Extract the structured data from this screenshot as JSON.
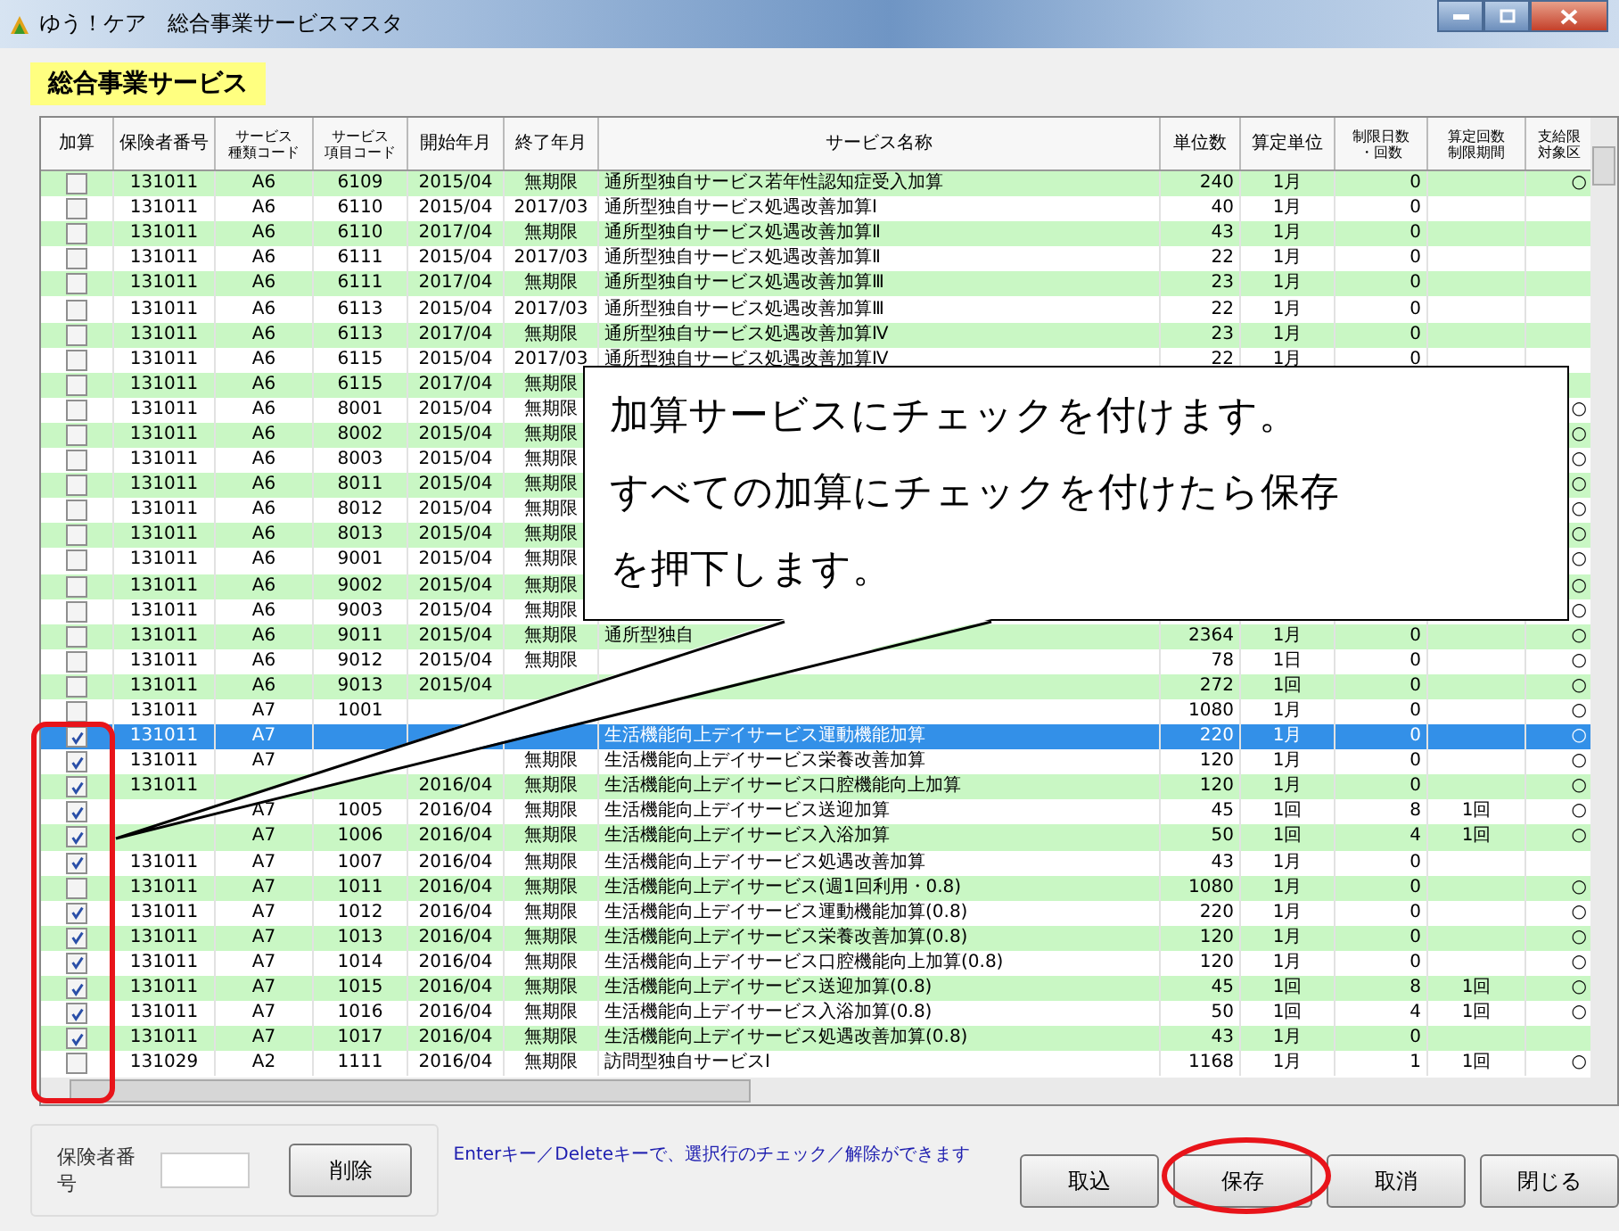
{
  "window": {
    "title": "ゆう！ケア　総合事業サービスマスタ"
  },
  "heading": "総合事業サービス",
  "table": {
    "columns": [
      {
        "lines": [
          "加算"
        ]
      },
      {
        "lines": [
          "保険者番号"
        ]
      },
      {
        "lines": [
          "サービス",
          "種類コード"
        ]
      },
      {
        "lines": [
          "サービス",
          "項目コード"
        ]
      },
      {
        "lines": [
          "開始年月"
        ]
      },
      {
        "lines": [
          "終了年月"
        ]
      },
      {
        "lines": [
          "サービス名称"
        ]
      },
      {
        "lines": [
          "単位数"
        ]
      },
      {
        "lines": [
          "算定単位"
        ]
      },
      {
        "lines": [
          "制限日数",
          "・回数"
        ]
      },
      {
        "lines": [
          "算定回数",
          "制限期間"
        ]
      },
      {
        "lines": [
          "支給限",
          "対象区"
        ]
      }
    ],
    "rows": [
      {
        "checked": false,
        "selected": false,
        "insurer": "131011",
        "type": "A6",
        "code": "6109",
        "start": "2015/04",
        "end": "無期限",
        "name": "通所型独自サービス若年性認知症受入加算",
        "units": "240",
        "unit": "1月",
        "limit": "0",
        "target": "○"
      },
      {
        "checked": false,
        "selected": false,
        "insurer": "131011",
        "type": "A6",
        "code": "6110",
        "start": "2015/04",
        "end": "2017/03",
        "name": "通所型独自サービス処遇改善加算Ⅰ",
        "units": "40",
        "unit": "1月",
        "limit": "0"
      },
      {
        "checked": false,
        "selected": false,
        "insurer": "131011",
        "type": "A6",
        "code": "6110",
        "start": "2017/04",
        "end": "無期限",
        "name": "通所型独自サービス処遇改善加算Ⅱ",
        "units": "43",
        "unit": "1月",
        "limit": "0"
      },
      {
        "checked": false,
        "selected": false,
        "insurer": "131011",
        "type": "A6",
        "code": "6111",
        "start": "2015/04",
        "end": "2017/03",
        "name": "通所型独自サービス処遇改善加算Ⅱ",
        "units": "22",
        "unit": "1月",
        "limit": "0"
      },
      {
        "checked": false,
        "selected": false,
        "insurer": "131011",
        "type": "A6",
        "code": "6111",
        "start": "2017/04",
        "end": "無期限",
        "name": "通所型独自サービス処遇改善加算Ⅲ",
        "units": "23",
        "unit": "1月",
        "limit": "0"
      },
      {
        "checked": false,
        "selected": false,
        "insurer": "131011",
        "type": "A6",
        "code": "6113",
        "start": "2015/04",
        "end": "2017/03",
        "name": "通所型独自サービス処遇改善加算Ⅲ",
        "units": "22",
        "unit": "1月",
        "limit": "0"
      },
      {
        "checked": false,
        "selected": false,
        "insurer": "131011",
        "type": "A6",
        "code": "6113",
        "start": "2017/04",
        "end": "無期限",
        "name": "通所型独自サービス処遇改善加算Ⅳ",
        "units": "23",
        "unit": "1月",
        "limit": "0"
      },
      {
        "checked": false,
        "selected": false,
        "insurer": "131011",
        "type": "A6",
        "code": "6115",
        "start": "2015/04",
        "end": "2017/03",
        "name": "通所型独自サービス処遇改善加算Ⅳ",
        "units": "22",
        "unit": "1月",
        "limit": "0"
      },
      {
        "checked": false,
        "selected": false,
        "insurer": "131011",
        "type": "A6",
        "code": "6115",
        "start": "2017/04",
        "end": "無期限"
      },
      {
        "checked": false,
        "selected": false,
        "insurer": "131011",
        "type": "A6",
        "code": "8001",
        "start": "2015/04",
        "end": "無期限",
        "target": "○"
      },
      {
        "checked": false,
        "selected": false,
        "insurer": "131011",
        "type": "A6",
        "code": "8002",
        "start": "2015/04",
        "end": "無期限",
        "target": "○"
      },
      {
        "checked": false,
        "selected": false,
        "insurer": "131011",
        "type": "A6",
        "code": "8003",
        "start": "2015/04",
        "end": "無期限",
        "target": "○"
      },
      {
        "checked": false,
        "selected": false,
        "insurer": "131011",
        "type": "A6",
        "code": "8011",
        "start": "2015/04",
        "end": "無期限",
        "target": "○"
      },
      {
        "checked": false,
        "selected": false,
        "insurer": "131011",
        "type": "A6",
        "code": "8012",
        "start": "2015/04",
        "end": "無期限",
        "target": "○"
      },
      {
        "checked": false,
        "selected": false,
        "insurer": "131011",
        "type": "A6",
        "code": "8013",
        "start": "2015/04",
        "end": "無期限",
        "target": "○"
      },
      {
        "checked": false,
        "selected": false,
        "insurer": "131011",
        "type": "A6",
        "code": "9001",
        "start": "2015/04",
        "end": "無期限",
        "target": "○"
      },
      {
        "checked": false,
        "selected": false,
        "insurer": "131011",
        "type": "A6",
        "code": "9002",
        "start": "2015/04",
        "end": "無期限",
        "target": "○"
      },
      {
        "checked": false,
        "selected": false,
        "insurer": "131011",
        "type": "A6",
        "code": "9003",
        "start": "2015/04",
        "end": "無期限",
        "target": "○"
      },
      {
        "checked": false,
        "selected": false,
        "insurer": "131011",
        "type": "A6",
        "code": "9011",
        "start": "2015/04",
        "end": "無期限",
        "name": "通所型独自",
        "units": "2364",
        "unit": "1月",
        "limit": "0",
        "target": "○"
      },
      {
        "checked": false,
        "selected": false,
        "insurer": "131011",
        "type": "A6",
        "code": "9012",
        "start": "2015/04",
        "end": "無期限",
        "units": "78",
        "unit": "1日",
        "limit": "0",
        "target": "○"
      },
      {
        "checked": false,
        "selected": false,
        "insurer": "131011",
        "type": "A6",
        "code": "9013",
        "start": "2015/04",
        "units": "272",
        "unit": "1回",
        "limit": "0",
        "target": "○"
      },
      {
        "checked": false,
        "selected": false,
        "insurer": "131011",
        "type": "A7",
        "code": "1001",
        "units": "1080",
        "unit": "1月",
        "limit": "0",
        "target": "○"
      },
      {
        "checked": true,
        "selected": true,
        "insurer": "131011",
        "type": "A7",
        "name": "生活機能向上デイサービス運動機能加算",
        "units": "220",
        "unit": "1月",
        "limit": "0",
        "target": "○"
      },
      {
        "checked": true,
        "selected": false,
        "insurer": "131011",
        "type": "A7",
        "end": "無期限",
        "name": "生活機能向上デイサービス栄養改善加算",
        "units": "120",
        "unit": "1月",
        "limit": "0",
        "target": "○"
      },
      {
        "checked": true,
        "selected": false,
        "insurer": "131011",
        "start": "2016/04",
        "end": "無期限",
        "name": "生活機能向上デイサービス口腔機能向上加算",
        "units": "120",
        "unit": "1月",
        "limit": "0",
        "target": "○"
      },
      {
        "checked": true,
        "selected": false,
        "type": "A7",
        "code": "1005",
        "start": "2016/04",
        "end": "無期限",
        "name": "生活機能向上デイサービス送迎加算",
        "units": "45",
        "unit": "1回",
        "limit": "8",
        "period": "1回",
        "target": "○"
      },
      {
        "checked": true,
        "selected": false,
        "type": "A7",
        "code": "1006",
        "start": "2016/04",
        "end": "無期限",
        "name": "生活機能向上デイサービス入浴加算",
        "units": "50",
        "unit": "1回",
        "limit": "4",
        "period": "1回",
        "target": "○"
      },
      {
        "checked": true,
        "selected": false,
        "insurer": "131011",
        "type": "A7",
        "code": "1007",
        "start": "2016/04",
        "end": "無期限",
        "name": "生活機能向上デイサービス処遇改善加算",
        "units": "43",
        "unit": "1月",
        "limit": "0"
      },
      {
        "checked": false,
        "selected": false,
        "insurer": "131011",
        "type": "A7",
        "code": "1011",
        "start": "2016/04",
        "end": "無期限",
        "name": "生活機能向上デイサービス(週1回利用・0.8)",
        "units": "1080",
        "unit": "1月",
        "limit": "0",
        "target": "○"
      },
      {
        "checked": true,
        "selected": false,
        "insurer": "131011",
        "type": "A7",
        "code": "1012",
        "start": "2016/04",
        "end": "無期限",
        "name": "生活機能向上デイサービス運動機能加算(0.8)",
        "units": "220",
        "unit": "1月",
        "limit": "0",
        "target": "○"
      },
      {
        "checked": true,
        "selected": false,
        "insurer": "131011",
        "type": "A7",
        "code": "1013",
        "start": "2016/04",
        "end": "無期限",
        "name": "生活機能向上デイサービス栄養改善加算(0.8)",
        "units": "120",
        "unit": "1月",
        "limit": "0",
        "target": "○"
      },
      {
        "checked": true,
        "selected": false,
        "insurer": "131011",
        "type": "A7",
        "code": "1014",
        "start": "2016/04",
        "end": "無期限",
        "name": "生活機能向上デイサービス口腔機能向上加算(0.8)",
        "units": "120",
        "unit": "1月",
        "limit": "0",
        "target": "○"
      },
      {
        "checked": true,
        "selected": false,
        "insurer": "131011",
        "type": "A7",
        "code": "1015",
        "start": "2016/04",
        "end": "無期限",
        "name": "生活機能向上デイサービス送迎加算(0.8)",
        "units": "45",
        "unit": "1回",
        "limit": "8",
        "period": "1回",
        "target": "○"
      },
      {
        "checked": true,
        "selected": false,
        "insurer": "131011",
        "type": "A7",
        "code": "1016",
        "start": "2016/04",
        "end": "無期限",
        "name": "生活機能向上デイサービス入浴加算(0.8)",
        "units": "50",
        "unit": "1回",
        "limit": "4",
        "period": "1回",
        "target": "○"
      },
      {
        "checked": true,
        "selected": false,
        "insurer": "131011",
        "type": "A7",
        "code": "1017",
        "start": "2016/04",
        "end": "無期限",
        "name": "生活機能向上デイサービス処遇改善加算(0.8)",
        "units": "43",
        "unit": "1月",
        "limit": "0"
      },
      {
        "checked": false,
        "selected": false,
        "insurer": "131029",
        "type": "A2",
        "code": "1111",
        "start": "2016/04",
        "end": "無期限",
        "name": "訪問型独自サービスⅠ",
        "units": "1168",
        "unit": "1月",
        "limit": "1",
        "period": "1回",
        "target": "○"
      }
    ]
  },
  "callout": [
    "加算サービスにチェックを付けます。",
    "すべての加算にチェックを付けたら保存",
    "を押下します。"
  ],
  "footer": {
    "insurer_label": "保険者番号",
    "delete_button": "削除",
    "hint": "Enterキー／Deleteキーで、選択行のチェック／解除ができます",
    "buttons": [
      "取込",
      "保存",
      "取消",
      "閉じる"
    ]
  }
}
